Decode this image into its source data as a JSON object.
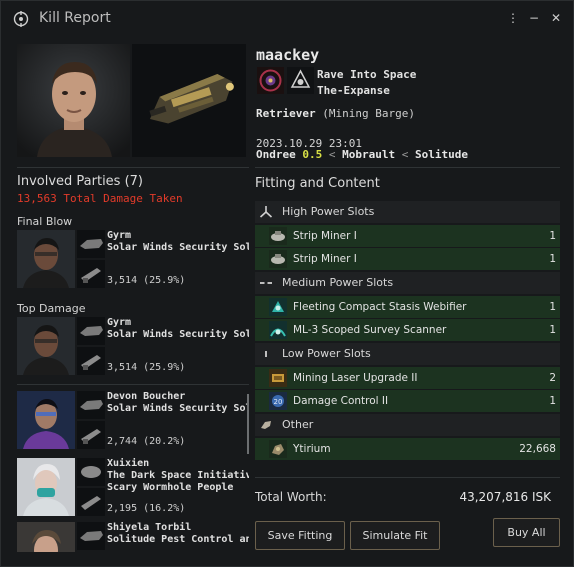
{
  "window": {
    "title": "Kill Report",
    "more_label": "⋮",
    "minimize_label": "−",
    "close_label": "✕"
  },
  "victim": {
    "name": "maackey",
    "corporation": "Rave Into Space",
    "alliance": "The-Expanse",
    "ship_name": "Retriever",
    "ship_class": "(Mining Barge)",
    "date": "2023.10.29 23:01",
    "system": "Ondree",
    "security": "0.5",
    "constellation": "Mobrault",
    "region": "Solitude"
  },
  "involved": {
    "title": "Involved Parties (7)",
    "total_damage": "13,563 Total Damage Taken",
    "final_blow_label": "Final Blow",
    "top_damage_label": "Top Damage",
    "final_blow": {
      "name": "Gyrm",
      "corp": "Solar Winds Security Solutions",
      "damage": "3,514 (25.9%)"
    },
    "top_damage": {
      "name": "Gyrm",
      "corp": "Solar Winds Security Solutions",
      "damage": "3,514 (25.9%)"
    },
    "others": [
      {
        "name": "Devon Boucher",
        "corp": "Solar Winds Security Solutions",
        "corp2": "",
        "damage": "2,744 (20.2%)"
      },
      {
        "name": "Xuixien",
        "corp": "The Dark Space Initiative",
        "corp2": "Scary Wormhole People",
        "damage": "2,195 (16.2%)"
      },
      {
        "name": "Shiyela Torbil",
        "corp": "Solitude Pest Control and Extermination",
        "corp2": "",
        "damage": ""
      }
    ]
  },
  "fitting": {
    "title": "Fitting and Content",
    "high_label": "High Power Slots",
    "medium_label": "Medium Power Slots",
    "low_label": "Low Power Slots",
    "other_label": "Other",
    "high": [
      {
        "name": "Strip Miner I",
        "qty": "1"
      },
      {
        "name": "Strip Miner I",
        "qty": "1"
      }
    ],
    "medium": [
      {
        "name": "Fleeting Compact Stasis Webifier",
        "qty": "1"
      },
      {
        "name": "ML-3 Scoped Survey Scanner",
        "qty": "1"
      }
    ],
    "low": [
      {
        "name": "Mining Laser Upgrade II",
        "qty": "2"
      },
      {
        "name": "Damage Control II",
        "qty": "1"
      }
    ],
    "other": [
      {
        "name": "Ytirium",
        "qty": "22,668"
      }
    ],
    "total_label": "Total Worth:",
    "total_value": "43,207,816 ISK"
  },
  "buttons": {
    "save_fitting": "Save Fitting",
    "simulate_fit": "Simulate Fit",
    "buy_all": "Buy All"
  },
  "colors": {
    "damage_red": "#e23b2a",
    "security_yellow": "#d8e046",
    "item_row_green": "#1c3320",
    "button_border": "#6b604c"
  }
}
